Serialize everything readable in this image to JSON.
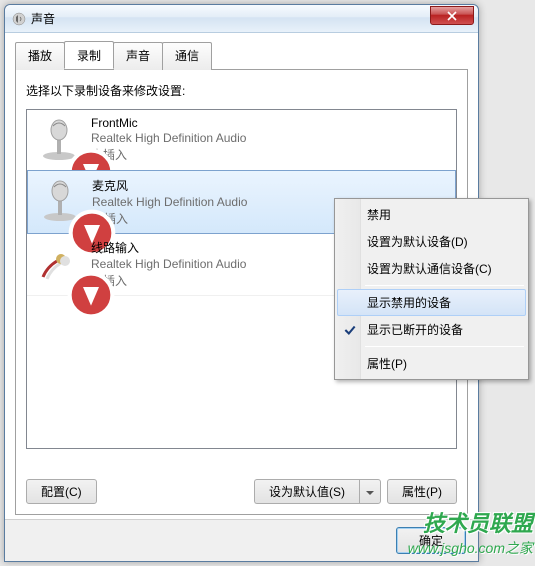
{
  "window": {
    "title": "声音"
  },
  "tabs": [
    {
      "label": "播放"
    },
    {
      "label": "录制"
    },
    {
      "label": "声音"
    },
    {
      "label": "通信"
    }
  ],
  "instruction": "选择以下录制设备来修改设置:",
  "devices": [
    {
      "name": "FrontMic",
      "desc": "Realtek High Definition Audio",
      "status": "未插入"
    },
    {
      "name": "麦克风",
      "desc": "Realtek High Definition Audio",
      "status": "未插入"
    },
    {
      "name": "线路输入",
      "desc": "Realtek High Definition Audio",
      "status": "未插入"
    }
  ],
  "buttons": {
    "configure": "配置(C)",
    "setDefault": "设为默认值(S)",
    "properties": "属性(P)",
    "ok": "确定"
  },
  "contextMenu": {
    "disable": "禁用",
    "setDefault": "设置为默认设备(D)",
    "setDefaultComm": "设置为默认通信设备(C)",
    "showDisabled": "显示禁用的设备",
    "showDisconnected": "显示已断开的设备",
    "properties": "属性(P)"
  },
  "watermark": {
    "line1": "技术员联盟",
    "line2": "www.jsgho.com之家"
  }
}
